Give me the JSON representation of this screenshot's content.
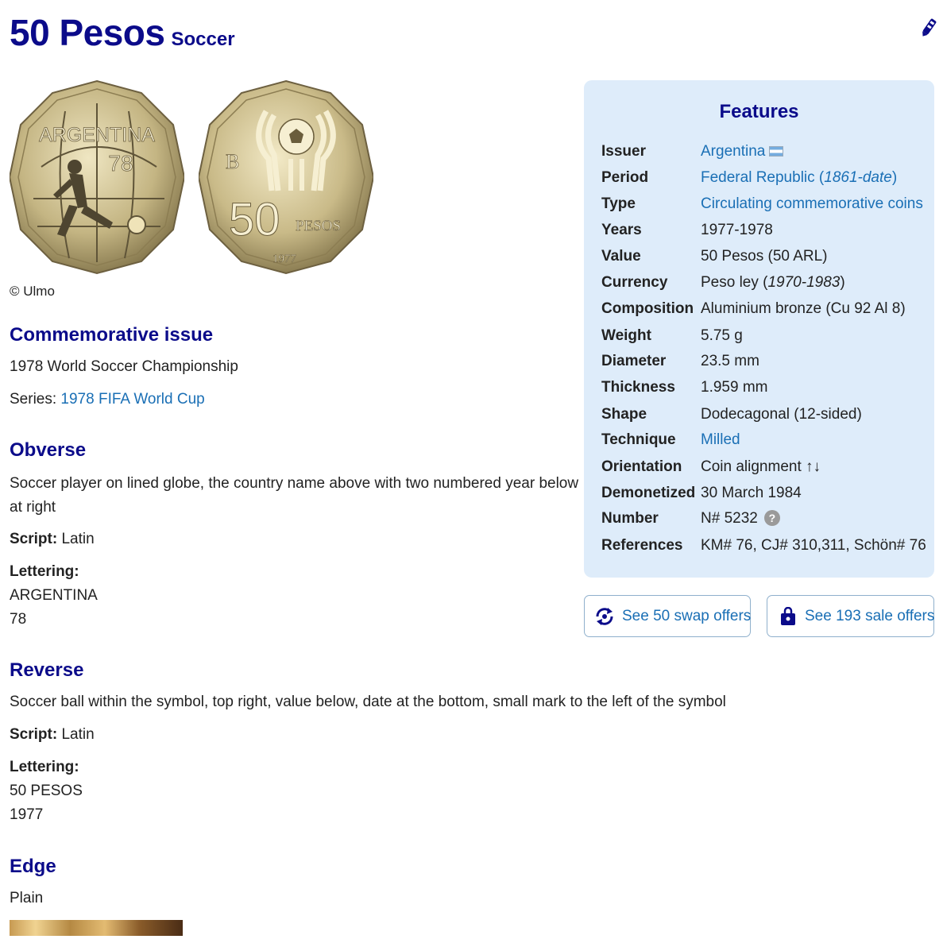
{
  "header": {
    "title": "50 Pesos",
    "subtitle": "Soccer",
    "corner_icon": "edit-icon"
  },
  "images": {
    "obverse_label": "ARGENTINA",
    "obverse_year": "78",
    "reverse_value": "50",
    "reverse_unit": "PESOS",
    "reverse_date": "1977",
    "reverse_mark": "B"
  },
  "credit": "© Ulmo",
  "commemorative": {
    "heading": "Commemorative issue",
    "text": "1978 World Soccer Championship",
    "series_label": "Series:",
    "series_value": "1978 FIFA World Cup"
  },
  "obverse": {
    "heading": "Obverse",
    "description": "Soccer player on lined globe, the country name above with two numbered year below at right",
    "script_label": "Script:",
    "script_value": "Latin",
    "lettering_label": "Lettering:",
    "lettering_lines": [
      "ARGENTINA",
      "78"
    ]
  },
  "reverse": {
    "heading": "Reverse",
    "description": "Soccer ball within the symbol, top right, value below, date at the bottom, small mark to the left of the symbol",
    "script_label": "Script:",
    "script_value": "Latin",
    "lettering_label": "Lettering:",
    "lettering_lines": [
      "50 PESOS",
      "1977"
    ]
  },
  "edge": {
    "heading": "Edge",
    "value": "Plain"
  },
  "features": {
    "heading": "Features",
    "rows": [
      {
        "key": "Issuer",
        "value": "Argentina"
      },
      {
        "key": "Period",
        "value": "Federal Republic (",
        "value_italic": "1861-date",
        "value_end": ")"
      },
      {
        "key": "Type",
        "value": "Circulating commemorative coins"
      },
      {
        "key": "Years",
        "value": "1977-1978"
      },
      {
        "key": "Value",
        "value": "50 Pesos (50 ARL)"
      },
      {
        "key": "Currency",
        "value": "Peso ley (",
        "value_italic": "1970-1983",
        "value_end": ")"
      },
      {
        "key": "Composition",
        "value": "Aluminium bronze (Cu 92 Al 8)"
      },
      {
        "key": "Weight",
        "value": "5.75 g"
      },
      {
        "key": "Diameter",
        "value": "23.5 mm"
      },
      {
        "key": "Thickness",
        "value": "1.959 mm"
      },
      {
        "key": "Shape",
        "value": "Dodecagonal (12-sided)"
      },
      {
        "key": "Technique",
        "value": "Milled"
      },
      {
        "key": "Orientation",
        "value": "Coin alignment ↑↓"
      },
      {
        "key": "Demonetized",
        "value": "30 March 1984"
      },
      {
        "key": "Number",
        "value": "N# 5232"
      },
      {
        "key": "References",
        "value": "KM# 76, CJ# 310,311, Schön# 76"
      }
    ]
  },
  "buttons": {
    "swap_label": "See 50 swap offers",
    "sale_label": "See 193 sale offers"
  },
  "colors": {
    "heading": "#0b0b8a",
    "link": "#1a6fb5",
    "panel": "#deecfa"
  }
}
